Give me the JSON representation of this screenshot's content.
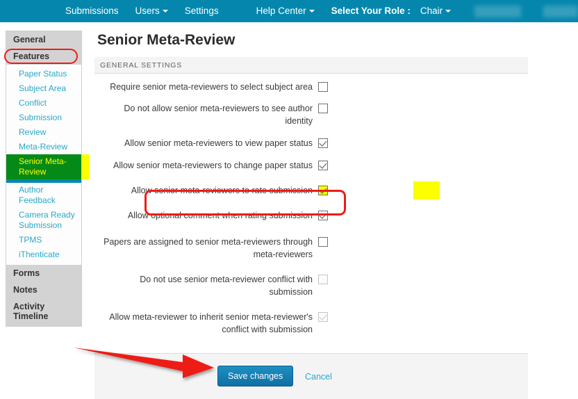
{
  "topnav": {
    "background": "#0587ad",
    "items": [
      {
        "label": "Submissions",
        "caret": false
      },
      {
        "label": "Users",
        "caret": true
      },
      {
        "label": "Settings",
        "caret": false
      },
      {
        "label": "Help Center",
        "caret": true
      },
      {
        "label": "Select Your Role :",
        "caret": false
      },
      {
        "label": "Chair",
        "caret": true
      }
    ],
    "redacted_blocks": 2
  },
  "sidebar": {
    "top_items": [
      {
        "label": "General"
      },
      {
        "label": "Features"
      }
    ],
    "sub_items": [
      {
        "label": "Paper Status",
        "active": false
      },
      {
        "label": "Subject Area",
        "active": false
      },
      {
        "label": "Conflict",
        "active": false
      },
      {
        "label": "Submission",
        "active": false
      },
      {
        "label": "Review",
        "active": false
      },
      {
        "label": "Meta-Review",
        "active": false
      },
      {
        "label": "Senior Meta-Review",
        "active": true
      },
      {
        "label": "Author Feedback",
        "active": false
      },
      {
        "label": "Camera Ready Submission",
        "active": false
      },
      {
        "label": "TPMS",
        "active": false
      },
      {
        "label": "iThenticate",
        "active": false
      }
    ],
    "bottom_items": [
      {
        "label": "Forms"
      },
      {
        "label": "Notes"
      },
      {
        "label": "Activity Timeline"
      }
    ],
    "active_color": "#068a17",
    "active_text_color": "#fcff00"
  },
  "main": {
    "title": "Senior Meta-Review",
    "section_header": "GENERAL SETTINGS",
    "settings": [
      {
        "label": "Require senior meta-reviewers to select subject area",
        "checked": false,
        "disabled": false,
        "highlighted": false
      },
      {
        "label": "Do not allow senior meta-reviewers to see author identity",
        "checked": false,
        "disabled": false,
        "highlighted": false
      },
      {
        "label": "Allow senior meta-reviewers to view paper status",
        "checked": true,
        "disabled": false,
        "highlighted": false
      },
      {
        "label": "Allow senior meta-reviewers to change paper status",
        "checked": true,
        "disabled": false,
        "highlighted": false
      },
      {
        "label": "Allow senior meta-reviewers to rate submission",
        "checked": true,
        "disabled": false,
        "highlighted": true
      },
      {
        "label": "Allow optional comment when rating submission",
        "checked": true,
        "disabled": false,
        "highlighted": false
      },
      {
        "label": "Papers are assigned to senior meta-reviewers through meta-reviewers",
        "checked": false,
        "disabled": false,
        "highlighted": false
      },
      {
        "label": "Do not use senior meta-reviewer conflict with submission",
        "checked": false,
        "disabled": true,
        "highlighted": false
      },
      {
        "label": "Allow meta-reviewer to inherit senior meta-reviewer's conflict with submission",
        "checked": true,
        "disabled": true,
        "highlighted": false
      }
    ]
  },
  "footer": {
    "save_label": "Save changes",
    "cancel_label": "Cancel"
  },
  "annotations": {
    "highlight_color": "#ee1b17",
    "checkbox_highlight_color": "#fcff00",
    "arrow_color": "#ee1b17"
  }
}
